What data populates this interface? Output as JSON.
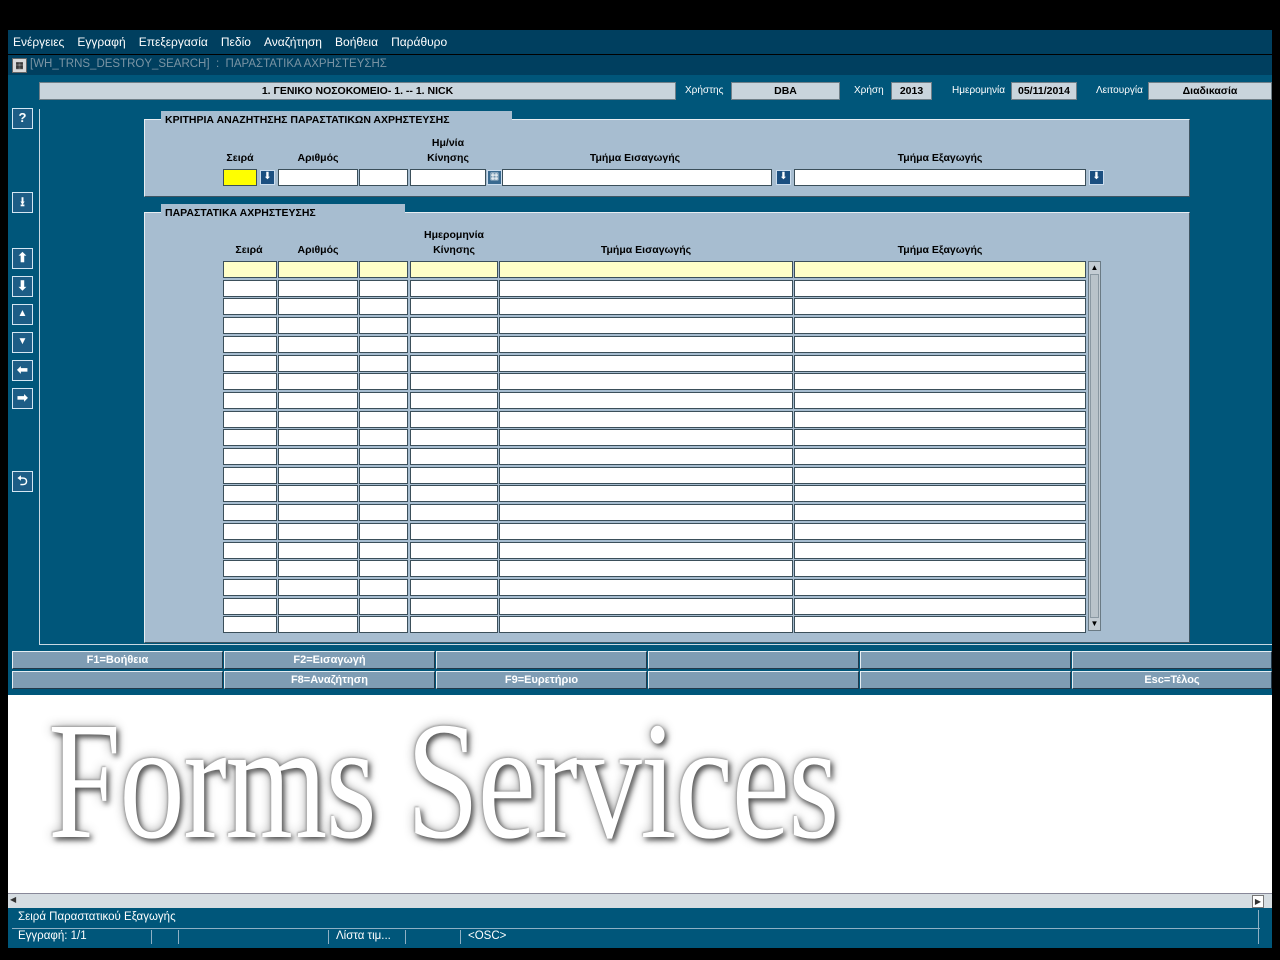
{
  "menu": [
    "Ενέργειες",
    "Εγγραφή",
    "Επεξεργασία",
    "Πεδίο",
    "Αναζήτηση",
    "Βοήθεια",
    "Παράθυρο"
  ],
  "window_title": "[WH_TRNS_DESTROY_SEARCH]  :  ΠΑΡΑΣΤΑΤΙΚΑ ΑΧΡΗΣΤΕΥΣΗΣ",
  "header": {
    "organization": "1. ΓΕΝΙΚΟ ΝΟΣΟΚΟΜΕΙΟ- 1. -- 1. NICK",
    "user_label": "Χρήστης",
    "user_value": "DBA",
    "year_label": "Χρήση",
    "year_value": "2013",
    "date_label": "Ημερομηνία",
    "date_value": "05/11/2014",
    "function_label": "Λειτουργία",
    "function_value": "Διαδικασία"
  },
  "criteria": {
    "title": "ΚΡΙΤΗΡΙΑ ΑΝΑΖΗΤΗΣΗΣ ΠΑΡΑΣΤΑΤΙΚΩΝ ΑΧΡΗΣΤΕΥΣΗΣ",
    "col_series": "Σειρά",
    "col_number": "Αριθμός",
    "col_date_line1": "Ημ/νία",
    "col_date_line2": "Κίνησης",
    "col_import_dept": "Τμήμα Εισαγωγής",
    "col_export_dept": "Τμήμα Εξαγωγής"
  },
  "results": {
    "title": "ΠΑΡΑΣΤΑΤΙΚΑ ΑΧΡΗΣΤΕΥΣΗΣ",
    "col_series": "Σειρά",
    "col_number": "Αριθμός",
    "col_date_line1": "Ημερομηνία",
    "col_date_line2": "Κίνησης",
    "col_import_dept": "Τμήμα Εισαγωγής",
    "col_export_dept": "Τμήμα Εξαγωγής",
    "row_count": 20
  },
  "side_buttons": {
    "help": "?",
    "lov": "arrow-down-doc-icon",
    "first": "first-record-icon",
    "last": "last-record-icon",
    "prev": "prev-record-icon",
    "next": "next-record-icon",
    "prev_block": "prev-block-icon",
    "next_block": "next-block-icon",
    "exit": "exit-icon"
  },
  "fkeys_row1": [
    "F1=Βοήθεια",
    "F2=Εισαγωγή",
    "",
    "",
    "",
    ""
  ],
  "fkeys_row2": [
    "",
    "F8=Αναζήτηση",
    "F9=Ευρετήριο",
    "",
    "",
    "Esc=Τέλος"
  ],
  "watermark": "Forms Services",
  "status": {
    "hint": "Σειρά Παραστατικού Εξαγωγής",
    "record": "Εγγραφή: 1/1",
    "list": "Λίστα τιμ...",
    "mode": "<OSC>"
  },
  "colors": {
    "canvas": "#00567a",
    "panel": "#a7bdd0",
    "selected_row": "#ffffc8",
    "focused_field": "#ffff00"
  }
}
